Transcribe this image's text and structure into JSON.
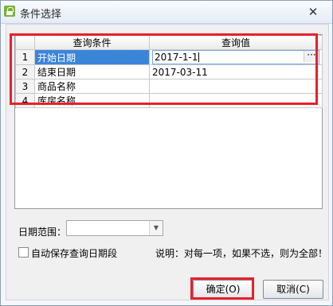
{
  "window": {
    "title": "条件选择",
    "close_glyph": "✕"
  },
  "grid": {
    "headers": [
      "",
      "查询条件",
      "查询值"
    ],
    "rows": [
      {
        "num": "1",
        "condition": "开始日期",
        "value": "2017-1-1"
      },
      {
        "num": "2",
        "condition": "结束日期",
        "value": "2017-03-11"
      },
      {
        "num": "3",
        "condition": "商品名称",
        "value": ""
      },
      {
        "num": "4",
        "condition": "库房名称",
        "value": ""
      }
    ],
    "ellipsis": "···"
  },
  "date_range": {
    "label": "日期范围：",
    "value": ""
  },
  "autosave": {
    "label": "自动保存查询日期段",
    "checked": false
  },
  "note": "说明：对每一项，如果不选，则为全部！",
  "buttons": {
    "ok": "确定(O)",
    "cancel": "取消(C)"
  },
  "colors": {
    "highlight": "#e8202a",
    "selection": "#3b85d9"
  }
}
